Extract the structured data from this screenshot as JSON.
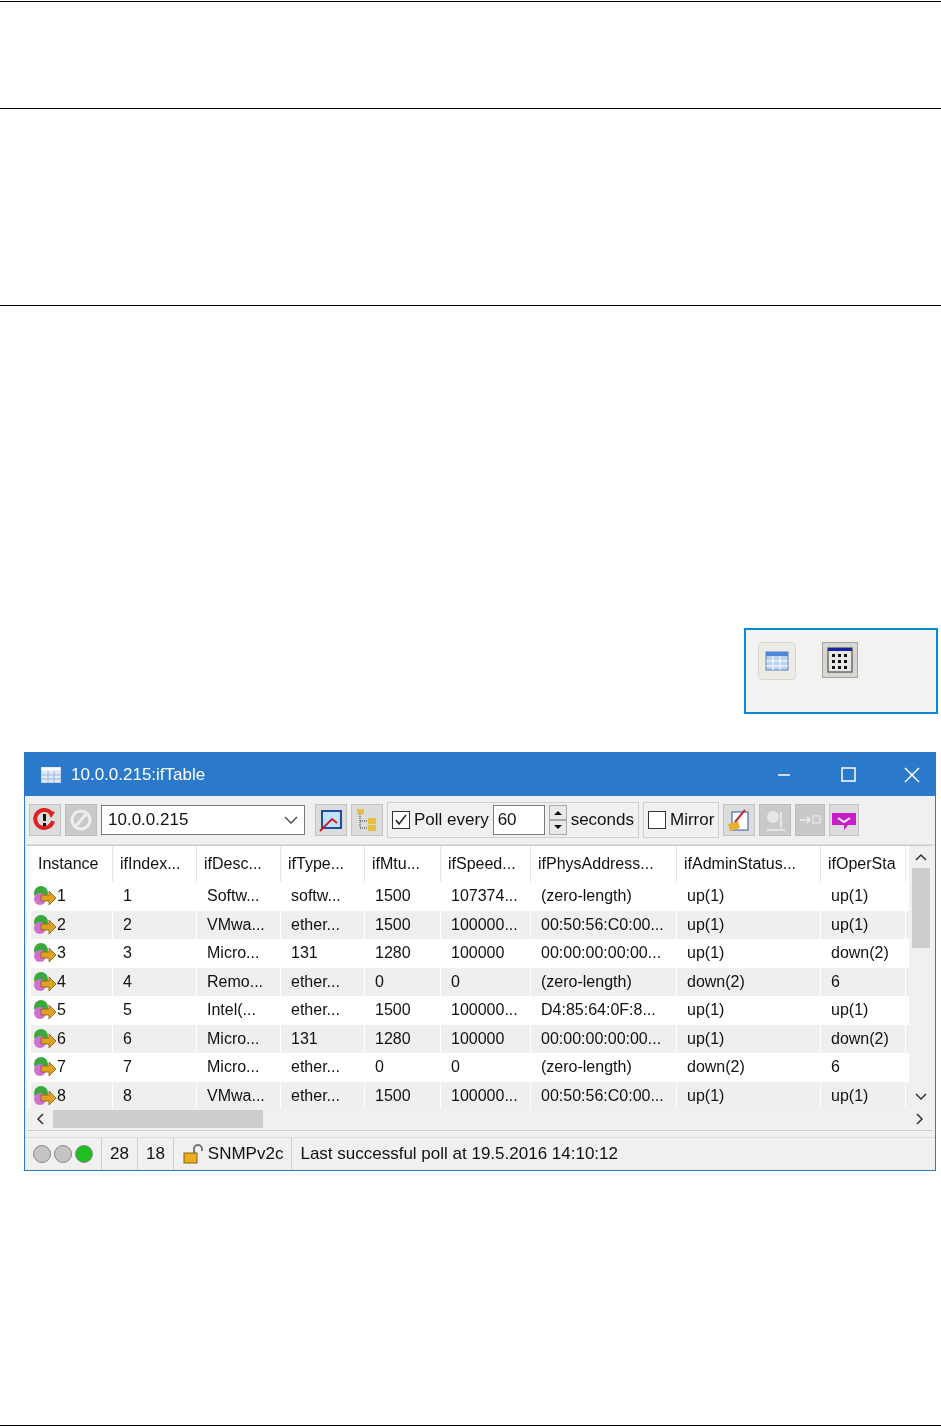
{
  "window": {
    "title": "10.0.0.215:ifTable"
  },
  "toolbar": {
    "address": "10.0.0.215",
    "poll_checked": true,
    "poll_label": "Poll every",
    "poll_value": "60",
    "poll_unit": "seconds",
    "mirror_checked": false,
    "mirror_label": "Mirror"
  },
  "table": {
    "columns": [
      "Instance",
      "ifIndex...",
      "ifDesc...",
      "ifType...",
      "ifMtu...",
      "ifSpeed...",
      "ifPhysAddress...",
      "ifAdminStatus...",
      "ifOperSta"
    ],
    "rows": [
      [
        "1",
        "1",
        "Softw...",
        "softw...",
        "1500",
        "107374...",
        "(zero-length)",
        "up(1)",
        "up(1)"
      ],
      [
        "2",
        "2",
        "VMwa...",
        "ether...",
        "1500",
        "100000...",
        "00:50:56:C0:00...",
        "up(1)",
        "up(1)"
      ],
      [
        "3",
        "3",
        "Micro...",
        "131",
        "1280",
        "100000",
        "00:00:00:00:00...",
        "up(1)",
        "down(2)"
      ],
      [
        "4",
        "4",
        "Remo...",
        "ether...",
        "0",
        "0",
        "(zero-length)",
        "down(2)",
        "6"
      ],
      [
        "5",
        "5",
        "Intel(...",
        "ether...",
        "1500",
        "100000...",
        "D4:85:64:0F:8...",
        "up(1)",
        "up(1)"
      ],
      [
        "6",
        "6",
        "Micro...",
        "131",
        "1280",
        "100000",
        "00:00:00:00:00...",
        "up(1)",
        "down(2)"
      ],
      [
        "7",
        "7",
        "Micro...",
        "ether...",
        "0",
        "0",
        "(zero-length)",
        "down(2)",
        "6"
      ],
      [
        "8",
        "8",
        "VMwa...",
        "ether...",
        "1500",
        "100000...",
        "00:50:56:C0:00...",
        "up(1)",
        "up(1)"
      ]
    ]
  },
  "status_bar": {
    "lights": [
      {
        "color": "#c4c4c4"
      },
      {
        "color": "#c4c4c4"
      },
      {
        "color": "#1fbf1f"
      }
    ],
    "count_1": "28",
    "count_2": "18",
    "protocol": "SNMPv2c",
    "message": "Last successful poll at 19.5.2016 14:10:12"
  }
}
